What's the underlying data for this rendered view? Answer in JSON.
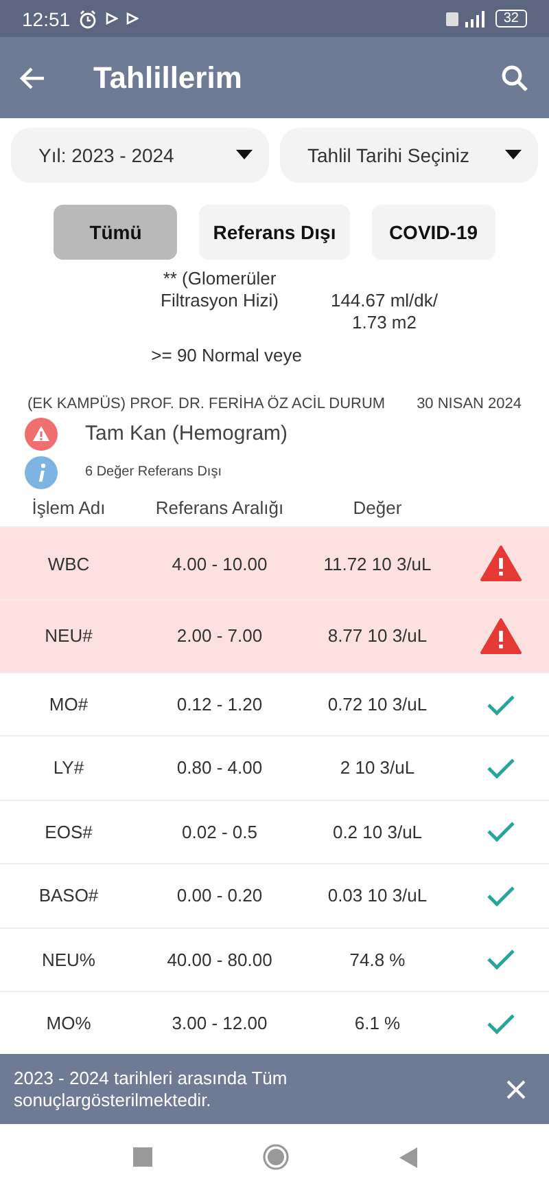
{
  "status_bar": {
    "time": "12:51",
    "battery": "32"
  },
  "app_bar": {
    "title": "Tahlillerim"
  },
  "filters": [
    {
      "label": "Yıl: 2023 - 2024"
    },
    {
      "label": "Tahlil Tarihi Seçiniz"
    }
  ],
  "chips": [
    {
      "label": "Tümü",
      "selected": true
    },
    {
      "label": "Referans Dışı",
      "selected": false
    },
    {
      "label": "COVID-19",
      "selected": false
    }
  ],
  "previous_result": {
    "name": "** (Glomerüler Filtrasyon Hizi)",
    "value": "144.67 ml/dk/ 1.73 m2",
    "range": ">= 90 Normal veye"
  },
  "report": {
    "hospital": "(EK KAMPÜS) PROF. DR. FERİHA ÖZ ACİL DURUM",
    "date": "30 NISAN 2024",
    "title": "Tam Kan (Hemogram)",
    "note": "6 Değer Referans Dışı"
  },
  "table": {
    "columns": [
      "İşlem Adı",
      "Referans Aralığı",
      "Değer"
    ],
    "rows": [
      {
        "name": "WBC",
        "range": "4.00 - 10.00",
        "value": "11.72 10 3/uL",
        "out_of_range": true
      },
      {
        "name": "NEU#",
        "range": "2.00 - 7.00",
        "value": "8.77 10 3/uL",
        "out_of_range": true
      },
      {
        "name": "MO#",
        "range": "0.12 - 1.20",
        "value": "0.72 10 3/uL",
        "out_of_range": false
      },
      {
        "name": "LY#",
        "range": "0.80 - 4.00",
        "value": "2 10 3/uL",
        "out_of_range": false
      },
      {
        "name": "EOS#",
        "range": "0.02 - 0.5",
        "value": "0.2 10 3/uL",
        "out_of_range": false
      },
      {
        "name": "BASO#",
        "range": "0.00 - 0.20",
        "value": "0.03 10 3/uL",
        "out_of_range": false
      },
      {
        "name": "NEU%",
        "range": "40.00 - 80.00",
        "value": "74.8 %",
        "out_of_range": false
      },
      {
        "name": "MO%",
        "range": "3.00 - 12.00",
        "value": "6.1 %",
        "out_of_range": false
      }
    ]
  },
  "snackbar": {
    "message": "2023 - 2024 tarihleri arasında Tüm sonuçlargösterilmektedir."
  }
}
